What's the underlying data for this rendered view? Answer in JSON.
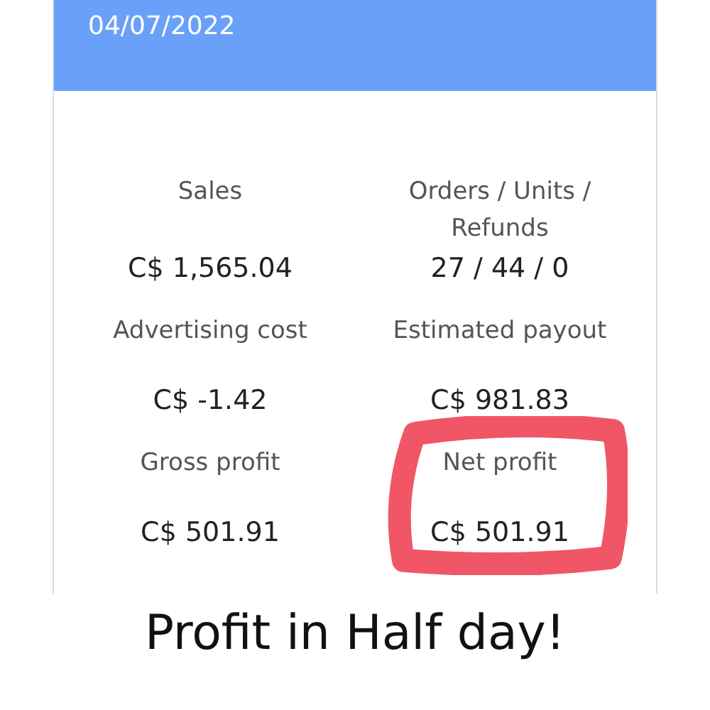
{
  "header": {
    "date": "04/07/2022"
  },
  "metrics": [
    {
      "label": "Sales",
      "value": "C$ 1,565.04",
      "highlighted": false
    },
    {
      "label": "Orders / Units / Refunds",
      "value": "27 / 44 / 0",
      "highlighted": false
    },
    {
      "label": "Advertising cost",
      "value": "C$ -1.42",
      "highlighted": false
    },
    {
      "label": "Estimated payout",
      "value": "C$ 981.83",
      "highlighted": false
    },
    {
      "label": "Gross profit",
      "value": "C$ 501.91",
      "highlighted": false
    },
    {
      "label": "Net profit",
      "value": "C$ 501.91",
      "highlighted": true
    }
  ],
  "caption": "Profit in Half day!"
}
